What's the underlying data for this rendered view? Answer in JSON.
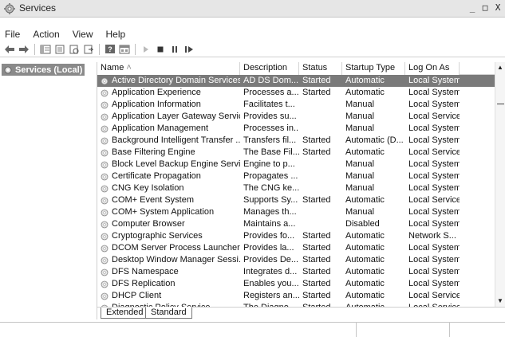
{
  "window": {
    "title": "Services",
    "minimize": "_",
    "maximize": "□",
    "close": "X"
  },
  "menu": [
    "File",
    "Action",
    "View",
    "Help"
  ],
  "toolbar": [
    "back-icon",
    "forward-icon",
    "show-hide-tree-icon",
    "properties-icon",
    "refresh-icon",
    "export-icon",
    "help-icon",
    "console-icon",
    "start-icon",
    "stop-icon",
    "pause-icon",
    "restart-icon"
  ],
  "tree": {
    "selected": "Services (Local)"
  },
  "table": {
    "columns": [
      "Name",
      "Description",
      "Status",
      "Startup Type",
      "Log On As"
    ],
    "sort_indicator": "˄",
    "rows": [
      [
        "Active Directory Domain Services",
        "AD DS Dom...",
        "Started",
        "Automatic",
        "Local System"
      ],
      [
        "Application Experience",
        "Processes a...",
        "Started",
        "Automatic",
        "Local System"
      ],
      [
        "Application Information",
        "Facilitates t...",
        "",
        "Manual",
        "Local System"
      ],
      [
        "Application Layer Gateway Service",
        "Provides su...",
        "",
        "Manual",
        "Local Service"
      ],
      [
        "Application Management",
        "Processes in...",
        "",
        "Manual",
        "Local System"
      ],
      [
        "Background Intelligent Transfer ...",
        "Transfers fil...",
        "Started",
        "Automatic (D...",
        "Local System"
      ],
      [
        "Base Filtering Engine",
        "The Base Fil...",
        "Started",
        "Automatic",
        "Local Service"
      ],
      [
        "Block Level Backup Engine Service",
        "Engine to p...",
        "",
        "Manual",
        "Local System"
      ],
      [
        "Certificate Propagation",
        "Propagates ...",
        "",
        "Manual",
        "Local System"
      ],
      [
        "CNG Key Isolation",
        "The CNG ke...",
        "",
        "Manual",
        "Local System"
      ],
      [
        "COM+ Event System",
        "Supports Sy...",
        "Started",
        "Automatic",
        "Local Service"
      ],
      [
        "COM+ System Application",
        "Manages th...",
        "",
        "Manual",
        "Local System"
      ],
      [
        "Computer Browser",
        "Maintains a...",
        "",
        "Disabled",
        "Local System"
      ],
      [
        "Cryptographic Services",
        "Provides fo...",
        "Started",
        "Automatic",
        "Network S..."
      ],
      [
        "DCOM Server Process Launcher",
        "Provides la...",
        "Started",
        "Automatic",
        "Local System"
      ],
      [
        "Desktop Window Manager Sessi...",
        "Provides De...",
        "Started",
        "Automatic",
        "Local System"
      ],
      [
        "DFS Namespace",
        "Integrates d...",
        "Started",
        "Automatic",
        "Local System"
      ],
      [
        "DFS Replication",
        "Enables you...",
        "Started",
        "Automatic",
        "Local System"
      ],
      [
        "DHCP Client",
        "Registers an...",
        "Started",
        "Automatic",
        "Local Service"
      ],
      [
        "Diagnostic Policy Service",
        "The Diagno...",
        "Started",
        "Automatic",
        "Local Service"
      ]
    ]
  },
  "tabs": [
    "Extended",
    "Standard"
  ],
  "scrollbar": {
    "up": "▲",
    "down": "▼"
  }
}
